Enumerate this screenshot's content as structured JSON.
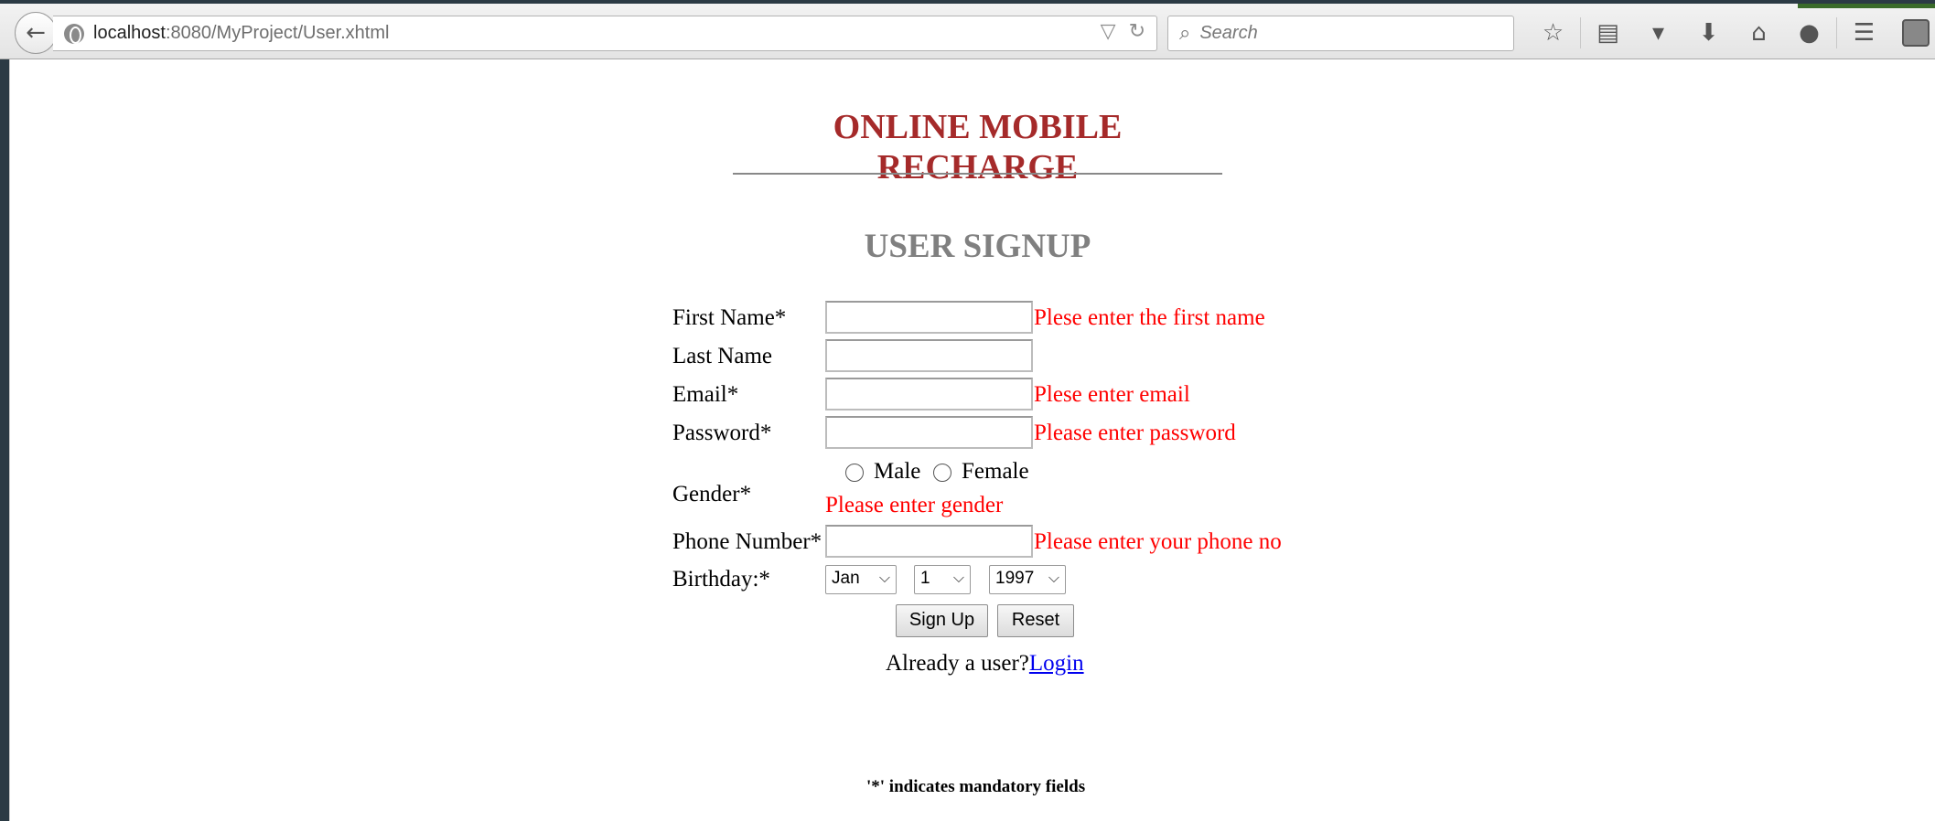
{
  "browser": {
    "url_host": "localhost",
    "url_path": ":8080/MyProject/User.xhtml",
    "search_placeholder": "Search"
  },
  "page": {
    "main_title": "ONLINE MOBILE RECHARGE",
    "subtitle": "USER SIGNUP",
    "form": {
      "first_name_label": "First Name*",
      "first_name_error": "Plese enter the first name",
      "last_name_label": "Last Name",
      "email_label": "Email*",
      "email_error": "Plese enter email",
      "password_label": "Password*",
      "password_error": "Please enter password",
      "gender_label": "Gender*",
      "gender_options": [
        "Male",
        "Female"
      ],
      "gender_error": "Please enter gender",
      "phone_label": "Phone Number*",
      "phone_error": "Please enter your phone no",
      "birthday_label": "Birthday:*",
      "birthday_month": "Jan",
      "birthday_day": "1",
      "birthday_year": "1997",
      "signup_button": "Sign Up",
      "reset_button": "Reset",
      "already_user_text": "Already a user?",
      "login_link": "Login"
    },
    "mandatory_note": "'*' indicates mandatory fields"
  }
}
